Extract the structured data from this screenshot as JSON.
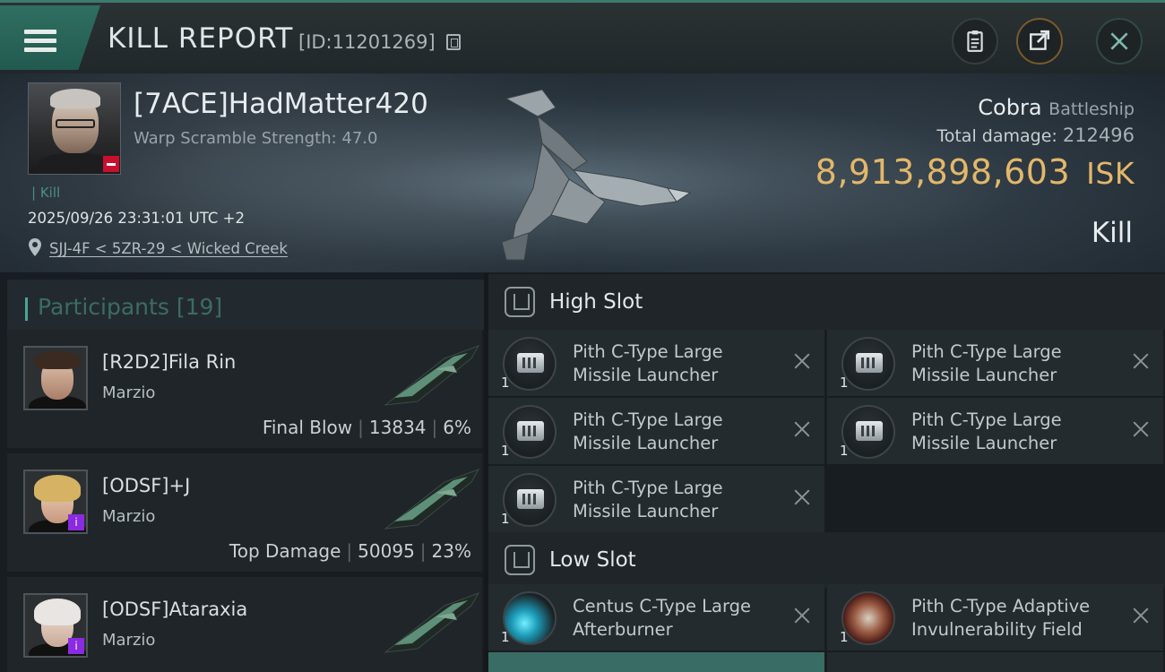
{
  "header": {
    "title": "KILL REPORT",
    "report_id": "[ID:11201269]"
  },
  "victim": {
    "name": "[7ACE]HadMatter420",
    "warp_scramble": "Warp Scramble Strength: 47.0",
    "kill_tag": "Kill",
    "datetime": "2025/09/26 23:31:01 UTC +2",
    "location": "SJJ-4F < 5ZR-29 < Wicked Creek",
    "ship_name": "Cobra",
    "ship_class": "Battleship",
    "total_damage_label": "Total damage:",
    "total_damage_value": "212496",
    "isk_value": "8,913,898,603",
    "isk_unit": "ISK",
    "result": "Kill"
  },
  "participants": {
    "label": "Participants",
    "count": "[19]",
    "items": [
      {
        "name": "[R2D2]Fila Rin",
        "corp": "Marzio",
        "role": "Final Blow",
        "damage": "13834",
        "percent": "6%"
      },
      {
        "name": "[ODSF]+J",
        "corp": "Marzio",
        "role": "Top Damage",
        "damage": "50095",
        "percent": "23%"
      },
      {
        "name": "[ODSF]Ataraxia",
        "corp": "Marzio"
      }
    ]
  },
  "slots": {
    "high": {
      "label": "High Slot",
      "modules": [
        {
          "name": "Pith C-Type Large Missile Launcher",
          "qty": "1"
        },
        {
          "name": "Pith C-Type Large Missile Launcher",
          "qty": "1"
        },
        {
          "name": "Pith C-Type Large Missile Launcher",
          "qty": "1"
        },
        {
          "name": "Pith C-Type Large Missile Launcher",
          "qty": "1"
        },
        {
          "name": "Pith C-Type Large Missile Launcher",
          "qty": "1"
        }
      ]
    },
    "low": {
      "label": "Low Slot",
      "modules": [
        {
          "name": "Centus C-Type Large Afterburner",
          "qty": "1"
        },
        {
          "name": "Pith C-Type Adaptive Invulnerability Field",
          "qty": "1"
        }
      ]
    }
  },
  "icons": {
    "menu": "hamburger-icon",
    "copy": "copy-icon",
    "clipboard": "clipboard-icon",
    "share": "share-icon",
    "close": "close-icon",
    "location": "location-pin-icon",
    "slot": "slot-icon",
    "remove": "close-x-icon"
  },
  "colors": {
    "accent": "#2f6f61",
    "isk": "#e3b76a",
    "minus_badge": "#c8102e",
    "badge_purple": "#8a2be2"
  }
}
